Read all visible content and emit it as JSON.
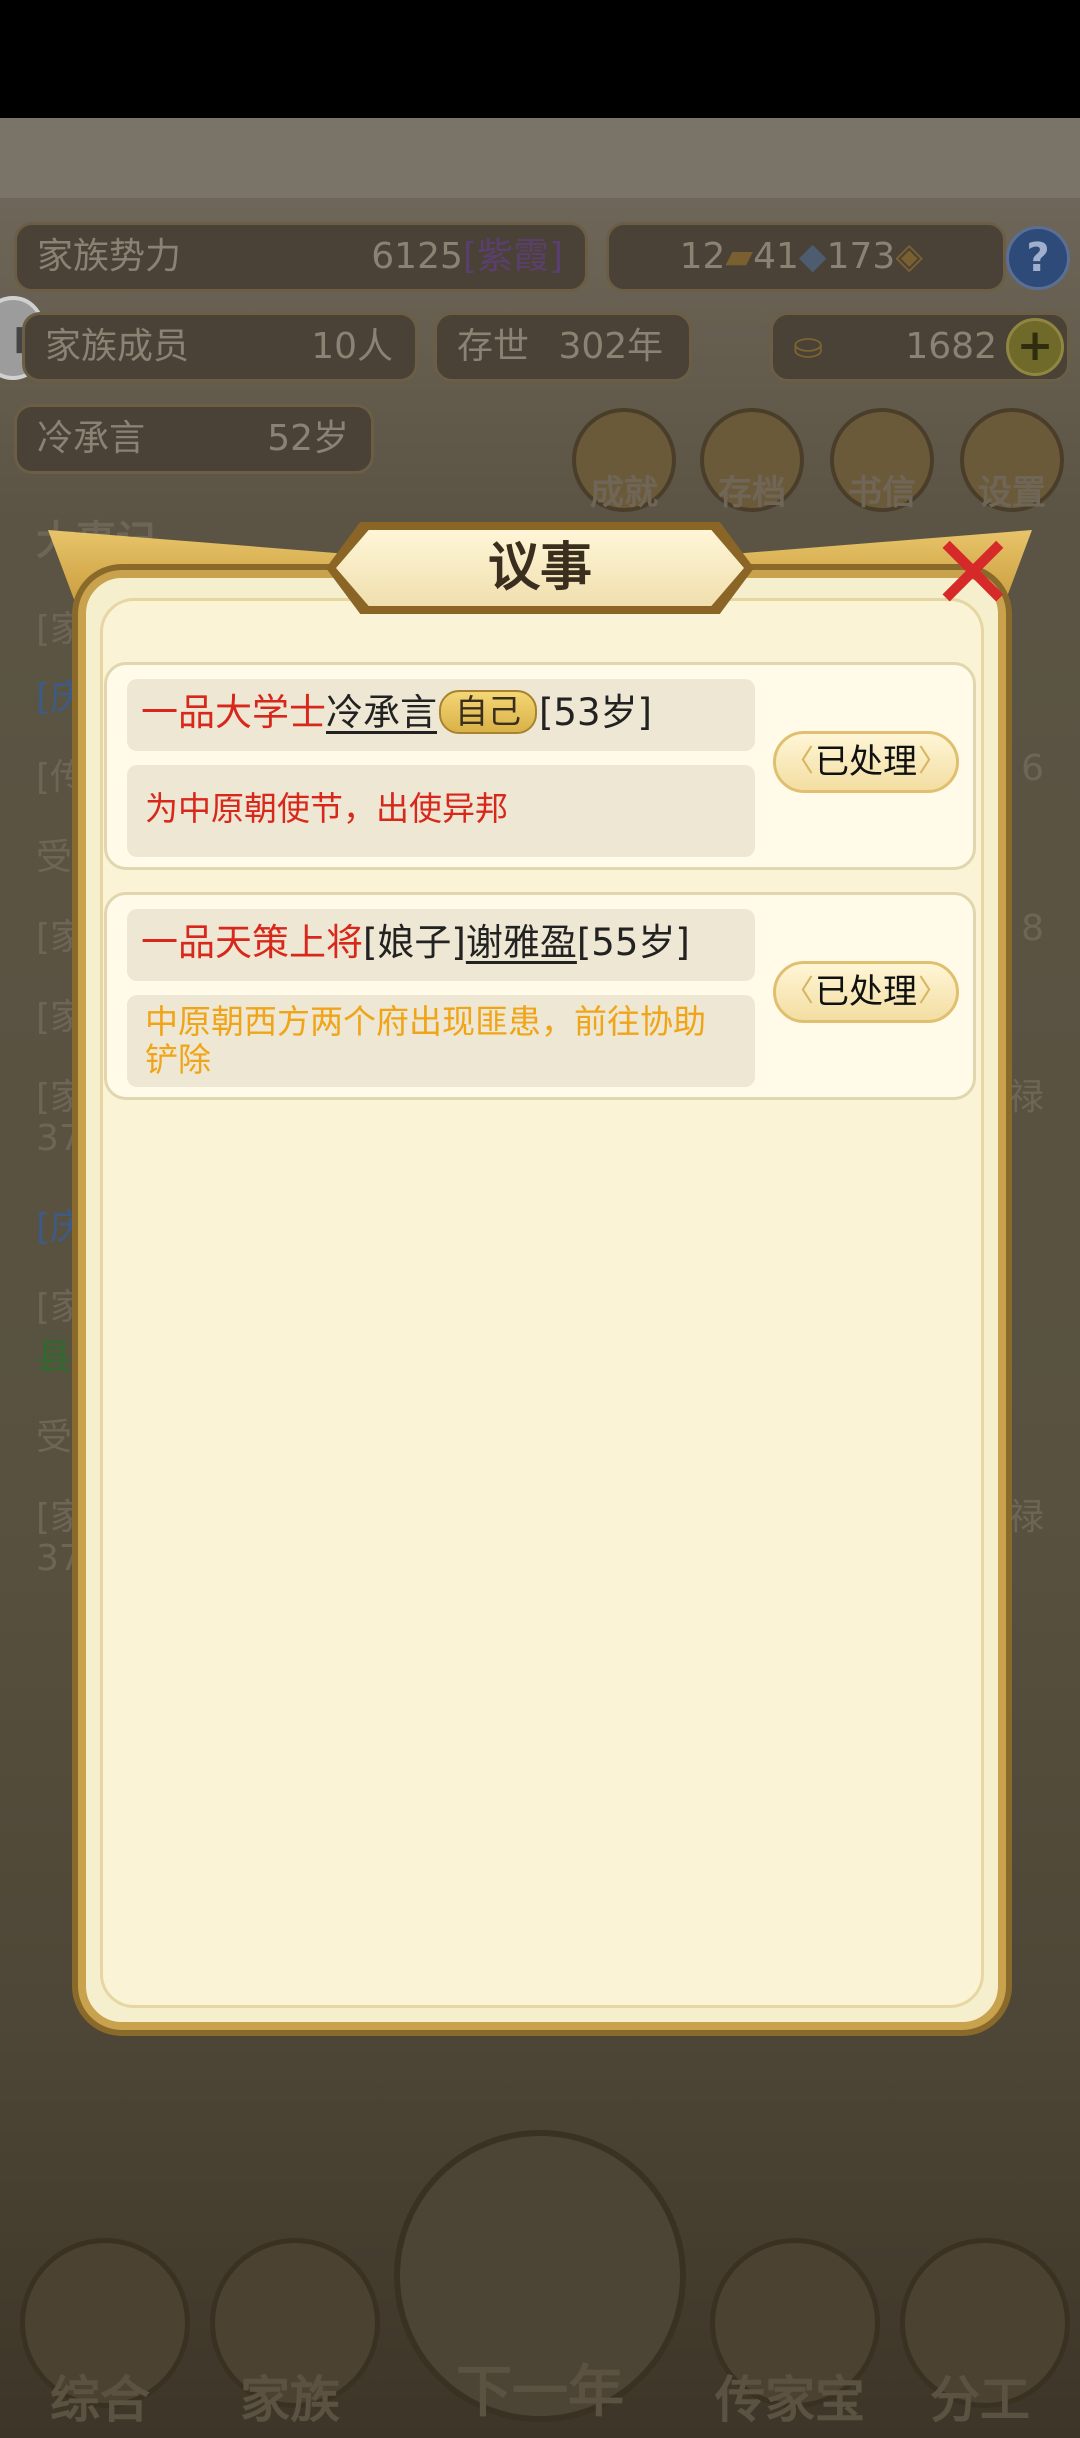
{
  "header": {
    "clan_power_label": "家族势力",
    "clan_power_value": "6125",
    "clan_power_rank": "[紫霞]",
    "gold_bars": "12",
    "silver": "41",
    "coins": "173",
    "help_icon": "question-icon",
    "members_label": "家族成员",
    "members_value": "10人",
    "existence_label": "存世",
    "existence_value": "302年",
    "ingots": "1682",
    "patriarch_name": "冷承言",
    "patriarch_age": "52岁"
  },
  "menu": {
    "achievement": "成就",
    "save": "存档",
    "letters": "书信",
    "settings": "设置"
  },
  "background_log": {
    "title": "大事记",
    "lines": [
      "[家",
      "[庆",
      "[传",
      "受",
      "[家",
      "[家",
      "[家",
      "37",
      "[庆",
      "[家",
      "县",
      "受",
      "[家",
      "37"
    ],
    "right_fragments": [
      "6",
      "8",
      "禄",
      "禄"
    ]
  },
  "bottom_nav": {
    "overview": "综合",
    "clan": "家族",
    "next_year": "下一年",
    "heirloom": "传家宝",
    "assign": "分工"
  },
  "modal": {
    "title": "议事",
    "items": [
      {
        "role": "一品大学士",
        "name": "冷承言",
        "tag": "自己",
        "age": "[53岁]",
        "description": "为中原朝使节，出使异邦",
        "status": "已处理"
      },
      {
        "role": "一品天策上将",
        "relation": "[娘子]",
        "name": "谢雅盈",
        "age": "[55岁]",
        "description": "中原朝西方两个府出现匪患，前往协助铲除",
        "status": "已处理"
      }
    ]
  },
  "colors": {
    "role_red": "#d8281c",
    "desc_orange": "#f0a418",
    "modal_bg": "#f6efce",
    "frame_gold": "#c9a24e"
  }
}
